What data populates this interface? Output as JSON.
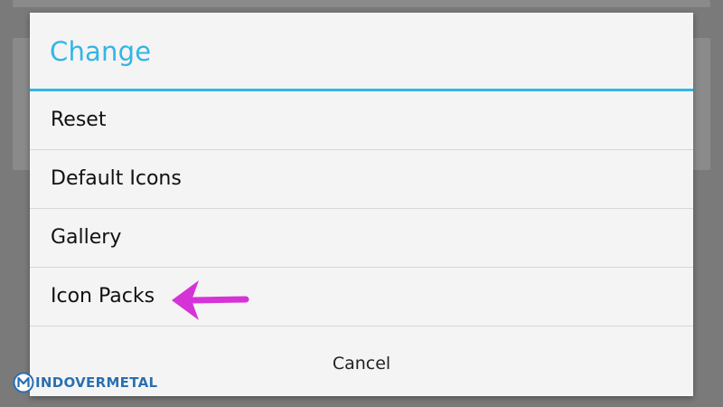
{
  "dialog": {
    "title": "Change",
    "items": [
      {
        "label": "Reset"
      },
      {
        "label": "Default Icons"
      },
      {
        "label": "Gallery"
      },
      {
        "label": "Icon Packs"
      }
    ],
    "cancel_label": "Cancel"
  },
  "annotation": {
    "arrow_color": "#d633d6",
    "arrow_icon": "arrow-left-icon",
    "points_to": "Icon Packs"
  },
  "watermark": {
    "text": "INDOVERMETAL",
    "color": "#2b6fb0"
  },
  "colors": {
    "accent": "#33b5e5",
    "dialog_bg": "#f4f4f4",
    "scrim": "#7a7a7a"
  }
}
